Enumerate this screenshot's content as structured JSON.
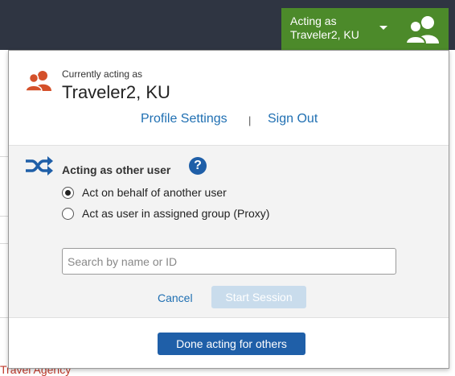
{
  "header": {
    "acting_button_line1": "Acting as",
    "acting_button_line2": "Traveler2, KU",
    "icon": "users-icon",
    "bar_color": "#2f3542",
    "button_color": "#4c8a2a"
  },
  "background": {
    "partial_text": "Travel Agency"
  },
  "panel": {
    "currently_acting_label": "Currently acting as",
    "current_user_name": "Traveler2, KU",
    "profile_settings_link": "Profile Settings",
    "separator": "|",
    "sign_out_link": "Sign Out",
    "section_title": "Acting as other user",
    "help_label": "?",
    "options": [
      {
        "label": "Act on behalf of another user",
        "selected": true
      },
      {
        "label": "Act as user in assigned group (Proxy)",
        "selected": false
      }
    ],
    "search_placeholder": "Search by name or ID",
    "search_value": "",
    "cancel_label": "Cancel",
    "start_session_label": "Start Session",
    "start_session_enabled": false,
    "done_label": "Done acting for others",
    "link_color": "#1f6fb2",
    "primary_color": "#1f5fa8",
    "accent_icon_color": "#d4502a"
  }
}
